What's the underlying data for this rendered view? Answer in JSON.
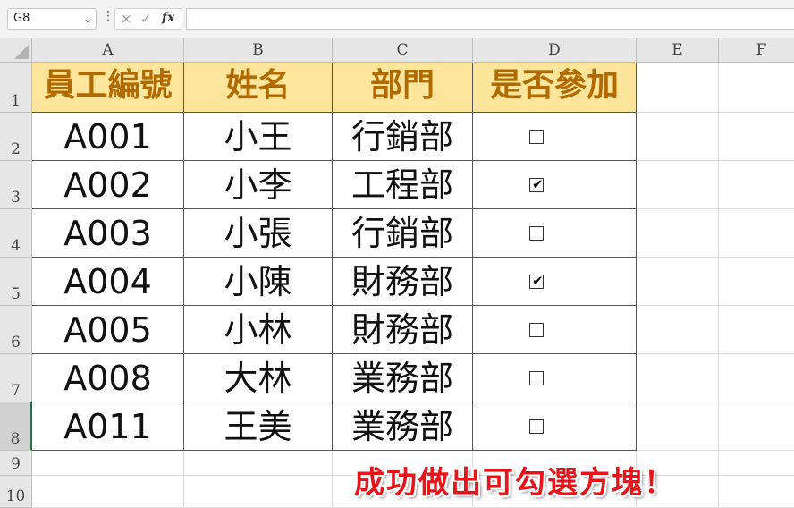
{
  "formula_bar": {
    "name_box": "G8",
    "cancel_icon": "×",
    "enter_icon": "✓",
    "fx_label": "fx",
    "formula": ""
  },
  "columns": [
    "A",
    "B",
    "C",
    "D",
    "E",
    "F"
  ],
  "rows": [
    "1",
    "2",
    "3",
    "4",
    "5",
    "6",
    "7",
    "8",
    "9",
    "10"
  ],
  "selected_row": "8",
  "table": {
    "headers": [
      "員工編號",
      "姓名",
      "部門",
      "是否參加"
    ],
    "records": [
      {
        "id": "A001",
        "name": "小王",
        "dept": "行銷部",
        "checked": false
      },
      {
        "id": "A002",
        "name": "小李",
        "dept": "工程部",
        "checked": true
      },
      {
        "id": "A003",
        "name": "小張",
        "dept": "行銷部",
        "checked": false
      },
      {
        "id": "A004",
        "name": "小陳",
        "dept": "財務部",
        "checked": true
      },
      {
        "id": "A005",
        "name": "小林",
        "dept": "財務部",
        "checked": false
      },
      {
        "id": "A008",
        "name": "大林",
        "dept": "業務部",
        "checked": false
      },
      {
        "id": "A011",
        "name": "王美",
        "dept": "業務部",
        "checked": false
      }
    ]
  },
  "banner_text": "成功做出可勾選方塊！",
  "colors": {
    "header_fill": "#fde59b",
    "header_text": "#b06a00",
    "banner": "#e8141a",
    "selection": "#217346"
  }
}
